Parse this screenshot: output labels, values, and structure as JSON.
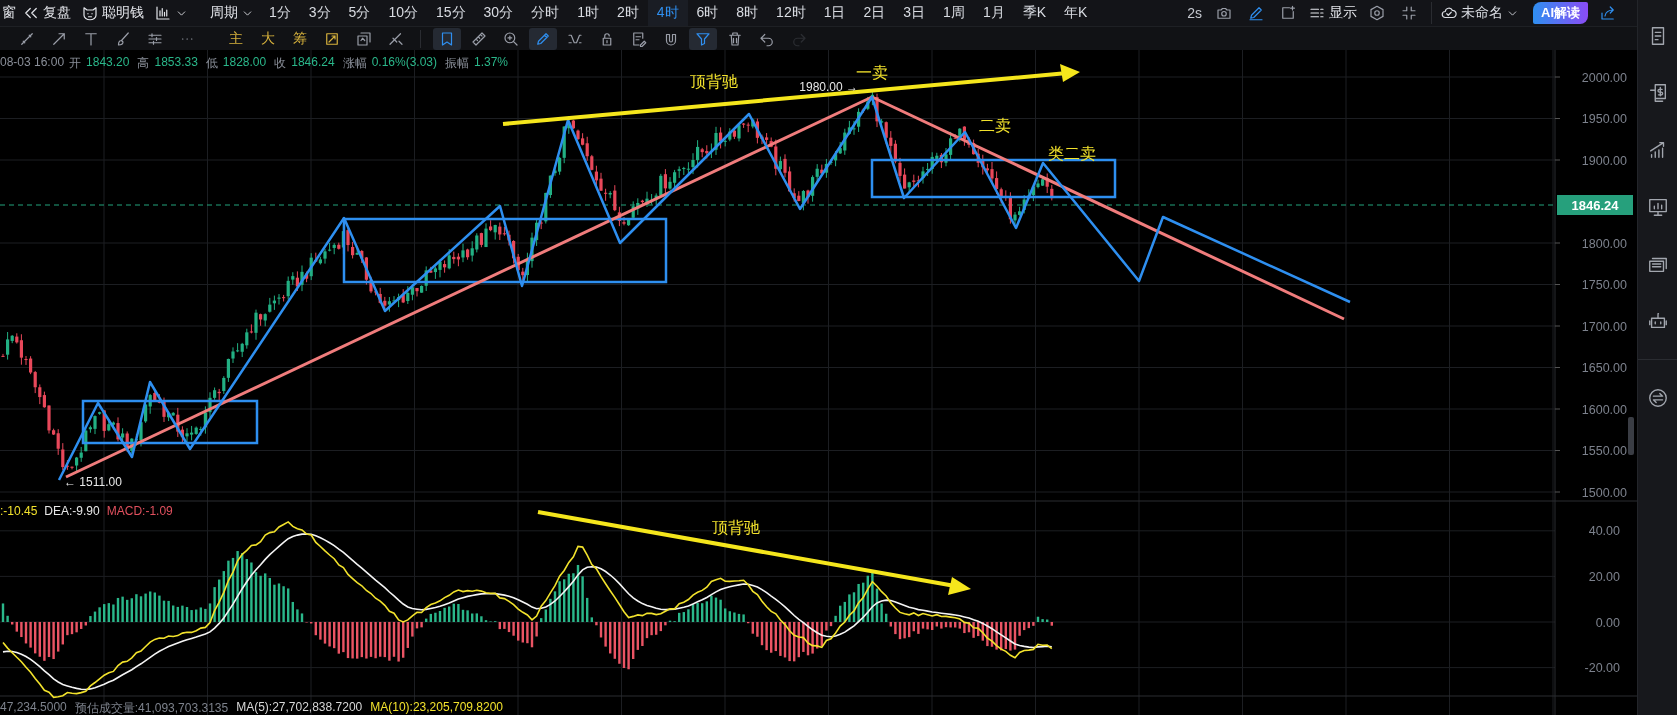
{
  "toolbar": {
    "window_menu": "窗",
    "replay": "复盘",
    "smart_money": "聪明钱",
    "period_menu": "周期",
    "periods": [
      {
        "label": "1分",
        "selected": false
      },
      {
        "label": "3分",
        "selected": false
      },
      {
        "label": "5分",
        "selected": false
      },
      {
        "label": "10分",
        "selected": false
      },
      {
        "label": "15分",
        "selected": false
      },
      {
        "label": "30分",
        "selected": false
      },
      {
        "label": "分时",
        "selected": false
      },
      {
        "label": "1时",
        "selected": false
      },
      {
        "label": "2时",
        "selected": false
      },
      {
        "label": "4时",
        "selected": true
      },
      {
        "label": "6时",
        "selected": false
      },
      {
        "label": "8时",
        "selected": false
      },
      {
        "label": "12时",
        "selected": false
      },
      {
        "label": "1日",
        "selected": false
      },
      {
        "label": "2日",
        "selected": false
      },
      {
        "label": "3日",
        "selected": false
      },
      {
        "label": "1周",
        "selected": false
      },
      {
        "label": "1月",
        "selected": false
      },
      {
        "label": "季K",
        "selected": false
      },
      {
        "label": "年K",
        "selected": false
      }
    ],
    "refresh": "2s",
    "display": "显示",
    "layout_name": "未命名",
    "ai_button": "AI解读"
  },
  "drawing_toolbar": {
    "labels": [
      "主",
      "大",
      "筹"
    ],
    "tools": [
      {
        "selected": true,
        "disabled": false
      },
      {
        "selected": false,
        "disabled": false
      },
      {
        "selected": false,
        "disabled": false
      },
      {
        "selected": true,
        "disabled": false
      },
      {
        "selected": false,
        "disabled": false
      },
      {
        "selected": false,
        "disabled": false
      },
      {
        "selected": false,
        "disabled": false
      },
      {
        "selected": false,
        "disabled": false
      },
      {
        "selected": true,
        "disabled": false
      },
      {
        "selected": false,
        "disabled": false
      },
      {
        "selected": false,
        "disabled": false
      },
      {
        "selected": false,
        "disabled": true
      }
    ]
  },
  "quote": {
    "time": "08-03 16:00",
    "fields": [
      {
        "label": "开",
        "value": "1843.20"
      },
      {
        "label": "高",
        "value": "1853.33"
      },
      {
        "label": "低",
        "value": "1828.00"
      },
      {
        "label": "收",
        "value": "1846.24"
      },
      {
        "label": "涨幅",
        "value": "0.16%(3.03)"
      },
      {
        "label": "振幅",
        "value": "1.37%"
      }
    ]
  },
  "price_chart": {
    "axis_labels": [
      "2000.00",
      "1950.00",
      "1900.00",
      "1800.00",
      "1750.00",
      "1700.00",
      "1650.00",
      "1600.00",
      "1550.00",
      "1500.00"
    ],
    "last_price": "1846.24",
    "annotations": [
      "顶背驰",
      "一卖",
      "二卖",
      "类二卖"
    ],
    "high_marker": "1980.00 →",
    "low_marker": "← 1511.00"
  },
  "macd": {
    "legend": [
      {
        "kind": "dif",
        "text": ":-10.45"
      },
      {
        "kind": "dea",
        "text": "DEA:-9.90"
      },
      {
        "kind": "macd",
        "text": "MACD:-1.09"
      }
    ],
    "annotation": "顶背驰",
    "axis_labels": [
      "40.00",
      "20.00",
      "0.00",
      "-20.00"
    ]
  },
  "volume": {
    "legend": [
      {
        "kind": "plain",
        "text": "47,234.5000"
      },
      {
        "kind": "plain",
        "text": "预估成交量:41,093,703.3135"
      },
      {
        "kind": "ma5",
        "text": "MA(5):27,702,838.7200"
      },
      {
        "kind": "ma10",
        "text": "MA(10):23,205,709.8200"
      }
    ]
  }
}
